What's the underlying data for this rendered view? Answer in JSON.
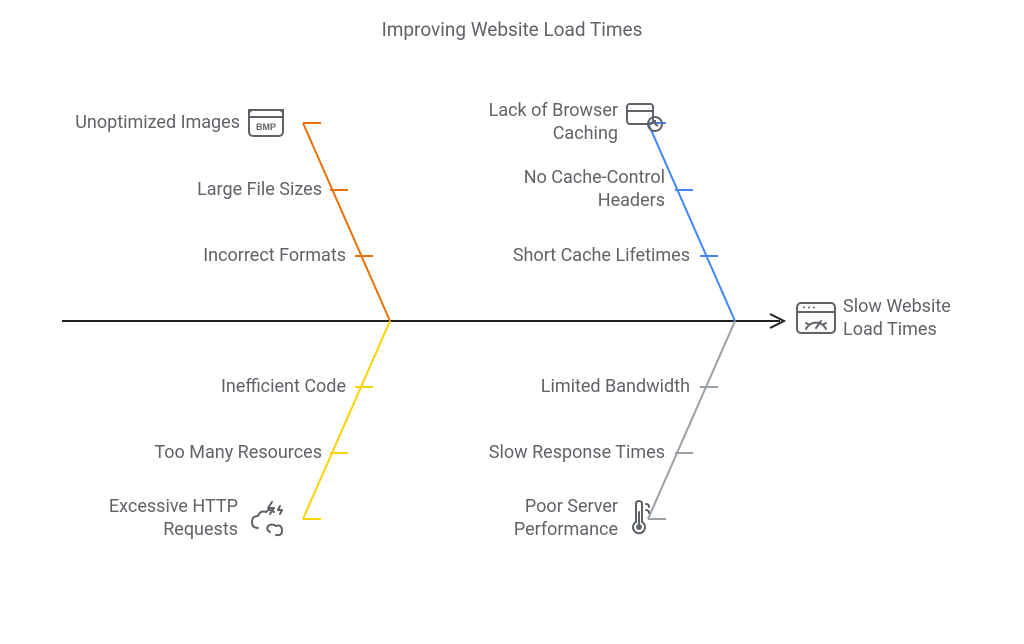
{
  "title": "Improving Website Load Times",
  "effect": {
    "label": "Slow Website Load Times"
  },
  "branches": {
    "top_left": {
      "color": "#e8710a",
      "category": "Unoptimized Images",
      "icon_badge": "BMP",
      "causes": [
        "Large File Sizes",
        "Incorrect Formats"
      ]
    },
    "top_right": {
      "color": "#4285f4",
      "category": "Lack of Browser Caching",
      "causes": [
        "No Cache-Control Headers",
        "Short Cache Lifetimes"
      ]
    },
    "bottom_left": {
      "color": "#f9d400",
      "category": "Excessive HTTP Requests",
      "causes": [
        "Inefficient Code",
        "Too Many Resources"
      ]
    },
    "bottom_right": {
      "color": "#9aa0a6",
      "category": "Poor Server Performance",
      "causes": [
        "Limited Bandwidth",
        "Slow Response Times"
      ]
    }
  }
}
